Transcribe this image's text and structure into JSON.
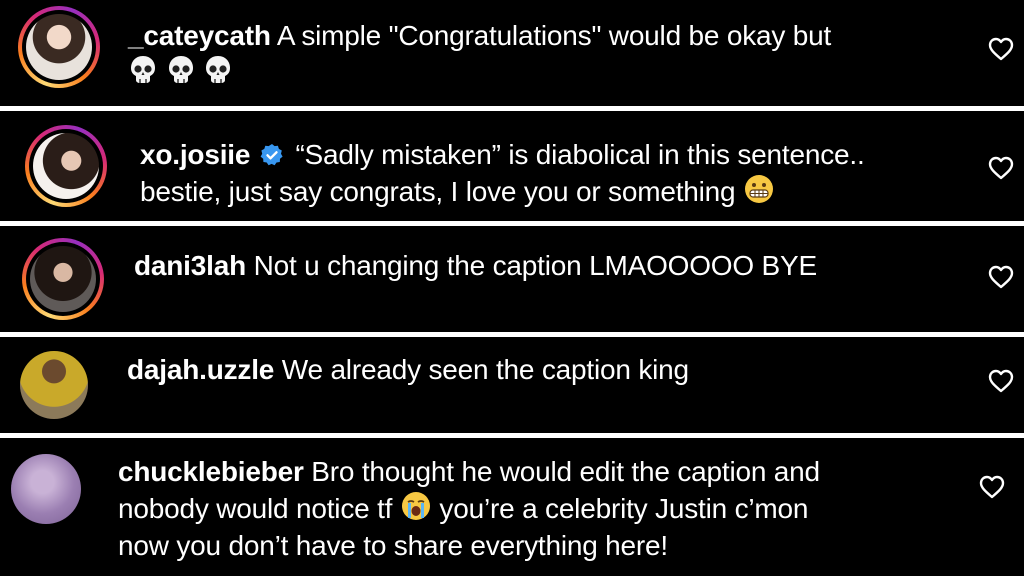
{
  "comments": [
    {
      "username": "_cateycath",
      "text": "A simple \"Congratulations\" would be okay but",
      "emoji_line": "skull skull skull",
      "verified": false,
      "avatar": "profile-photo-woman-dark-hair",
      "heart_icon": "heart-outline-icon"
    },
    {
      "username": "xo.josiie",
      "text": "“Sadly mistaken” is diabolical in this sentence..",
      "text_line2": "bestie, just say congrats, I love you or something",
      "emoji": "grimacing-face",
      "verified": true,
      "avatar": "profile-photo-woman-posing",
      "heart_icon": "heart-outline-icon"
    },
    {
      "username": "dani3lah",
      "text": "Not u changing the caption LMAOOOOO BYE",
      "verified": false,
      "avatar": "profile-photo-woman-long-hair",
      "heart_icon": "heart-outline-icon"
    },
    {
      "username": "dajah.uzzle",
      "text": "We already seen the caption king",
      "verified": false,
      "avatar": "profile-photo-person-yellow-jersey",
      "heart_icon": "heart-outline-icon"
    },
    {
      "username": "chucklebieber",
      "text": "Bro thought he would edit the caption and",
      "text_line2": "nobody would notice tf",
      "emoji": "loudly-crying-face",
      "text_line2_end": "you’re a celebrity Justin c’mon",
      "text_line3": "now you don’t have to share everything here!",
      "verified": false,
      "avatar": "profile-photo-purple-blur",
      "heart_icon": "heart-outline-icon"
    }
  ],
  "colors": {
    "background": "#000000",
    "separator": "#ffffff",
    "text": "#ffffff",
    "verified_badge": "#3897f0"
  }
}
